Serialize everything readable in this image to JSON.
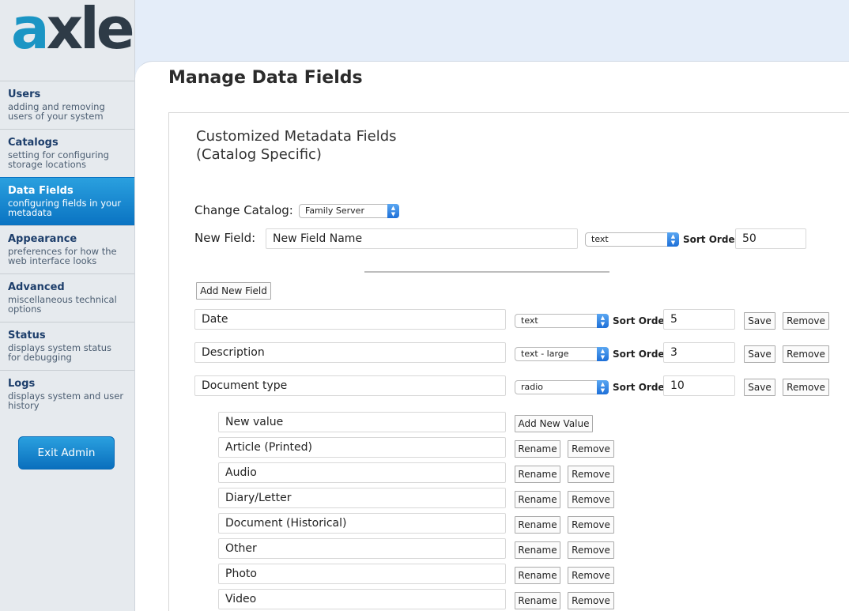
{
  "logo": {
    "a": "a",
    "rest": "xle"
  },
  "sidebar": {
    "items": [
      {
        "title": "Users",
        "desc": "adding and removing users of your system"
      },
      {
        "title": "Catalogs",
        "desc": "setting for configuring storage locations"
      },
      {
        "title": "Data Fields",
        "desc": "configuring fields in your metadata"
      },
      {
        "title": "Appearance",
        "desc": "preferences for how the web interface looks"
      },
      {
        "title": "Advanced",
        "desc": "miscellaneous technical options"
      },
      {
        "title": "Status",
        "desc": "displays system status for debugging"
      },
      {
        "title": "Logs",
        "desc": "displays system and user history"
      }
    ],
    "active_index": 2,
    "exit_label": "Exit Admin"
  },
  "main": {
    "title": "Manage Data Fields",
    "section_title_line1": "Customized Metadata Fields",
    "section_title_line2": "(Catalog Specific)",
    "change_catalog_label": "Change Catalog:",
    "catalog_selected": "Family Server",
    "new_field_label": "New Field:",
    "new_field_value": "New Field Name",
    "new_field_type": "text",
    "sort_order_label": "Sort Order:",
    "new_field_sort": "50",
    "add_new_field_label": "Add New Field",
    "save_label": "Save",
    "remove_label": "Remove",
    "rename_label": "Rename",
    "add_new_value_label": "Add New Value",
    "new_value_placeholder": "New value"
  },
  "fields": [
    {
      "name": "Date",
      "type": "text",
      "sort": "5"
    },
    {
      "name": "Description",
      "type": "text - large",
      "sort": "3"
    },
    {
      "name": "Document type",
      "type": "radio",
      "sort": "10"
    }
  ],
  "values": [
    "Article (Printed)",
    "Audio",
    "Diary/Letter",
    "Document (Historical)",
    "Other",
    "Photo",
    "Video"
  ],
  "colors": {
    "accent": "#1b95c4",
    "active_nav": "#0a73c2",
    "background": "#e4edf9"
  }
}
